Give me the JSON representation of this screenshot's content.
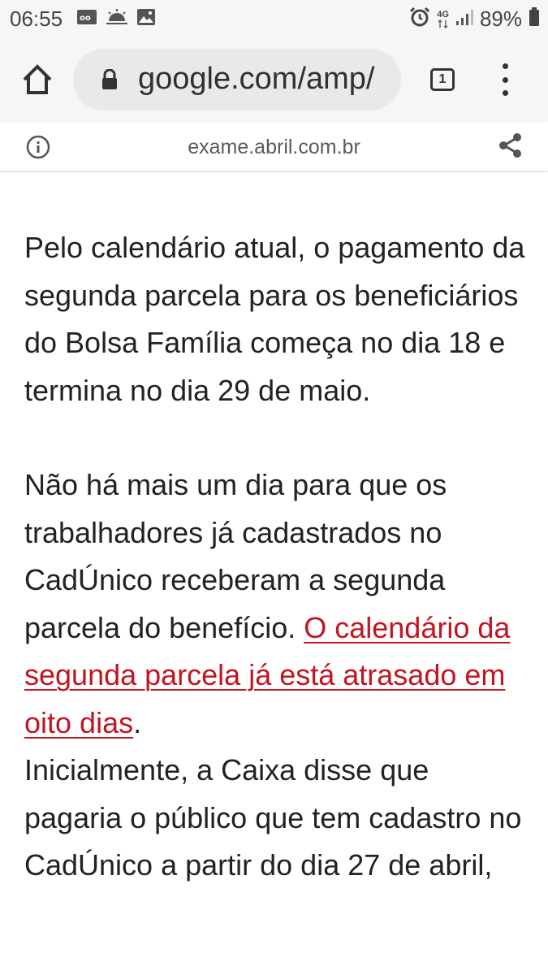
{
  "status_bar": {
    "time": "06:55",
    "network": "4G",
    "battery": "89%",
    "left_icons": [
      "voicemail-icon",
      "weather-icon",
      "image-icon"
    ],
    "right_icons": [
      "alarm-icon",
      "network-arrows-icon",
      "signal-icon",
      "battery-icon"
    ]
  },
  "browser": {
    "url": "google.com/amp/",
    "tab_count": "1",
    "icons": [
      "home-icon",
      "lock-icon",
      "tabs-icon",
      "menu-icon"
    ]
  },
  "amp_bar": {
    "domain": "exame.abril.com.br",
    "icons": [
      "info-icon",
      "share-icon"
    ]
  },
  "article": {
    "paragraph1": "Pelo calendário atual, o pagamento da segunda parcela para os beneficiários do Bolsa Família começa no dia 18 e termina no dia 29 de maio.",
    "paragraph2_before_link": "Não há mais um dia para que os trabalhadores já cadastrados no CadÚnico receberam a segunda parcela do benefício. ",
    "paragraph2_link": "O calendário da segunda parcela já está atrasado em oito dias",
    "paragraph2_after_link": ".",
    "paragraph3": "Inicialmente, a Caixa disse que pagaria o público que tem cadastro no CadÚnico a partir do dia 27 de abril,"
  },
  "colors": {
    "link": "#c2151f",
    "text": "#222222",
    "toolbar_bg": "#f6f6f6",
    "url_box_bg": "#e9e9ea"
  }
}
